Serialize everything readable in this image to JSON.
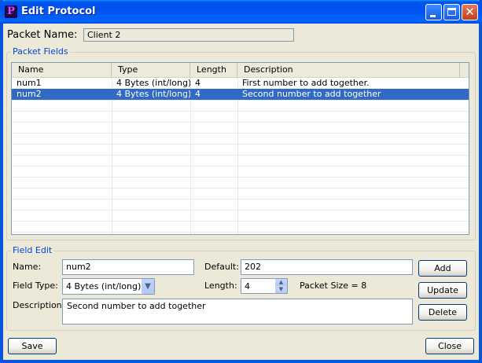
{
  "window": {
    "title": "Edit Protocol",
    "app_icon_letter": "P"
  },
  "packet": {
    "name_label": "Packet Name:",
    "name_value": "Client 2"
  },
  "packet_fields": {
    "group_title": "Packet Fields",
    "columns": [
      "Name",
      "Type",
      "Length",
      "Description"
    ],
    "rows": [
      {
        "name": "num1",
        "type": "4 Bytes (int/long)",
        "length": "4",
        "description": "First number to add together."
      },
      {
        "name": "num2",
        "type": "4 Bytes (int/long)",
        "length": "4",
        "description": "Second number to add together",
        "selected": true
      }
    ]
  },
  "field_edit": {
    "group_title": "Field Edit",
    "name_label": "Name:",
    "name_value": "num2",
    "default_label": "Default:",
    "default_value": "202",
    "field_type_label": "Field Type:",
    "field_type_value": "4 Bytes (int/long)",
    "length_label": "Length:",
    "length_value": "4",
    "packet_size_text": "Packet Size = 8",
    "description_label": "Description:",
    "description_value": "Second number to add together",
    "add_label": "Add",
    "update_label": "Update",
    "delete_label": "Delete"
  },
  "footer": {
    "save_label": "Save",
    "close_label": "Close"
  },
  "colors": {
    "selection": "#316ac5",
    "group_title": "#0046d5",
    "title_bar": "#0053ee"
  }
}
